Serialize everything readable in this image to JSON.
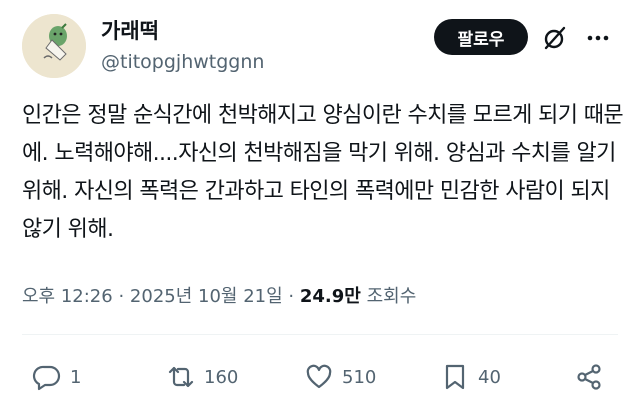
{
  "user": {
    "name": "가래떡",
    "handle": "@titopgjhwtggnn",
    "follow_label": "팔로우"
  },
  "tweet": {
    "text": "인간은 정말 순식간에 천박해지고 양심이란 수치를 모르게 되기 때문에. 노력해야해....자신의 천박해짐을 막기 위해. 양심과 수치를 알기 위해. 자신의 폭력은 간과하고 타인의 폭력에만 민감한 사람이 되지 않기 위해."
  },
  "meta": {
    "time": "오후 12:26",
    "sep": "·",
    "date": "2025년 10월 21일",
    "views": "24.9만",
    "views_label": "조회수"
  },
  "actions": {
    "replies": "1",
    "retweets": "160",
    "likes": "510",
    "bookmarks": "40"
  },
  "icons": [
    "grok-icon",
    "more-icon",
    "reply-icon",
    "retweet-icon",
    "like-icon",
    "bookmark-icon",
    "share-icon"
  ]
}
